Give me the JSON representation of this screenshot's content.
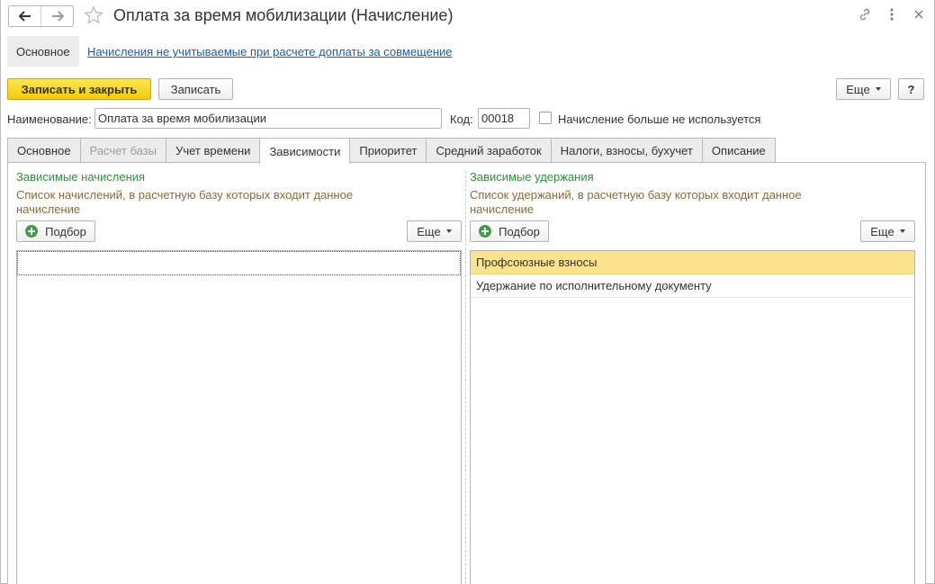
{
  "window": {
    "title": "Оплата за время мобилизации (Начисление)"
  },
  "nav": {
    "back_icon": "arrow-left-icon",
    "forward_icon": "arrow-right-icon",
    "favorite_icon": "star-icon"
  },
  "window_icons": [
    "link-icon",
    "more-icon",
    "close-icon"
  ],
  "sections": {
    "main": "Основное",
    "link": "Начисления не учитываемые при расчете доплаты за совмещение"
  },
  "toolbar": {
    "save_close": "Записать и закрыть",
    "save": "Записать",
    "more": "Еще",
    "help": "?"
  },
  "form": {
    "name_label": "Наименование:",
    "name_value": "Оплата за время мобилизации",
    "code_label": "Код:",
    "code_value": "00018",
    "not_used_label": "Начисление больше не используется"
  },
  "tabs": [
    {
      "label": "Основное"
    },
    {
      "label": "Расчет базы"
    },
    {
      "label": "Учет времени"
    },
    {
      "label": "Зависимости"
    },
    {
      "label": "Приоритет"
    },
    {
      "label": "Средний заработок"
    },
    {
      "label": "Налоги, взносы, бухучет"
    },
    {
      "label": "Описание"
    }
  ],
  "left_panel": {
    "title": "Зависимые начисления",
    "description": "Список начислений, в расчетную базу которых входит данное начисление",
    "pick_button": "Подбор",
    "more_button": "Еще",
    "rows": []
  },
  "right_panel": {
    "title": "Зависимые удержания",
    "description": "Список удержаний, в расчетную базу которых входит данное начисление",
    "pick_button": "Подбор",
    "more_button": "Еще",
    "rows": [
      "Профсоюзные взносы",
      "Удержание по исполнительному документу"
    ]
  },
  "colors": {
    "accent_yellow": "#f3cc0b",
    "group_title_green": "#2f8f3c",
    "description_brown": "#8b6a3c",
    "link_blue": "#1b5ea8",
    "row_selected": "#fbe28f"
  }
}
